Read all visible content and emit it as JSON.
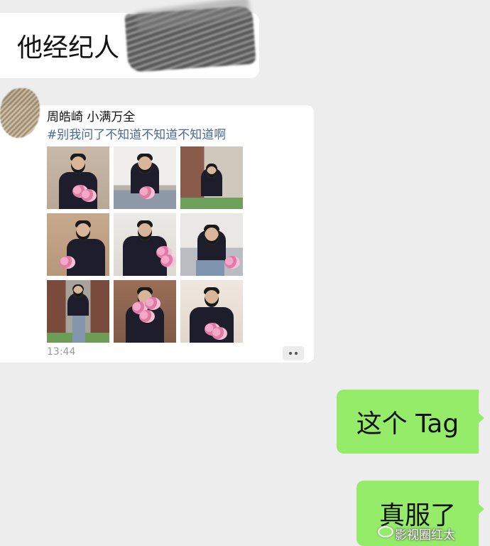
{
  "messages": {
    "incoming_text": "他经纪人",
    "shared_post": {
      "title": "周皓崎 小满万全",
      "tag": "#别我问了不知道不知道不知道啊",
      "time": "13:44",
      "photo_count": 9
    },
    "outgoing": [
      {
        "text": "这个 Tag"
      },
      {
        "text": "真服了"
      }
    ]
  },
  "watermark": "影视圈红太",
  "colors": {
    "background": "#ededed",
    "incoming_bubble": "#ffffff",
    "outgoing_bubble": "#95ec69",
    "tag_text": "#4a6a95"
  }
}
